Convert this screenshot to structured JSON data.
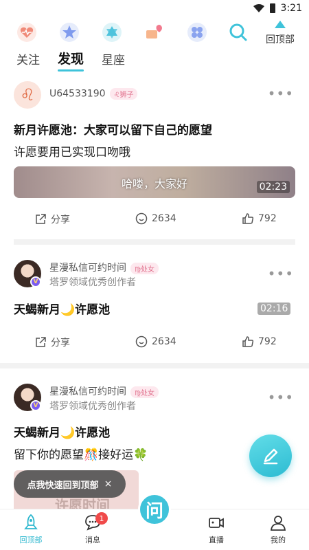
{
  "status_bar": {
    "time": "3:21"
  },
  "top_bar": {
    "icons": [
      "heart-pulse-icon",
      "star-badge-icon",
      "hexagram-icon",
      "love-letter-icon",
      "clover-grid-icon",
      "search-icon"
    ],
    "back_to_top_label": "回顶部"
  },
  "tabs": [
    {
      "label": "关注",
      "active": false
    },
    {
      "label": "发现",
      "active": true
    },
    {
      "label": "星座",
      "active": false
    }
  ],
  "posts": [
    {
      "username": "U64533190",
      "sign_tag": "♌狮子",
      "title": "新月许愿池：大家可以留下自己的愿望",
      "text": "许愿要用已实现口吻哦",
      "video_caption": "哈喽，大家好",
      "duration": "02:23",
      "share_label": "分享",
      "comments": "2634",
      "likes": "792"
    },
    {
      "username": "星漫私信可约时间",
      "sign_tag": "♍处女",
      "subtitle": "塔罗领域优秀创作者",
      "title": "天蝎新月🌙许愿池",
      "duration": "02:16",
      "share_label": "分享",
      "comments": "2634",
      "likes": "792"
    },
    {
      "username": "星漫私信可约时间",
      "sign_tag": "♍处女",
      "subtitle": "塔罗领域优秀创作者",
      "title": "天蝎新月🌙许愿池",
      "text": "留下你的愿望🎊接好运🍀",
      "thumb_text": "许愿时间"
    }
  ],
  "toast": {
    "label": "点我快速回到顶部",
    "close": "×"
  },
  "bottom_nav": [
    {
      "label": "回顶部",
      "active": true
    },
    {
      "label": "消息",
      "badge": "1"
    },
    {
      "label": "问",
      "center": true
    },
    {
      "label": "直播"
    },
    {
      "label": "我的"
    }
  ],
  "colors": {
    "accent": "#3fc3da",
    "badge": "#f04a4a",
    "tag": "#e0708c"
  }
}
